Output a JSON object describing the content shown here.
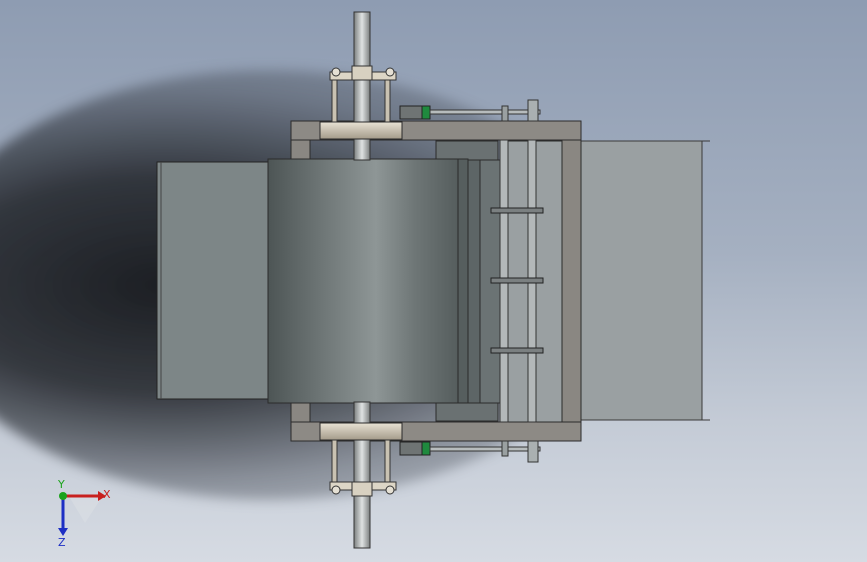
{
  "triad": {
    "x_label": "X",
    "y_label": "Y",
    "z_label": "Z"
  },
  "colors": {
    "axis_x": "#c8201e",
    "axis_y": "#1ba31b",
    "axis_z": "#1d2fc4",
    "frame": "#8d8a85",
    "drum": "#6d7575"
  }
}
